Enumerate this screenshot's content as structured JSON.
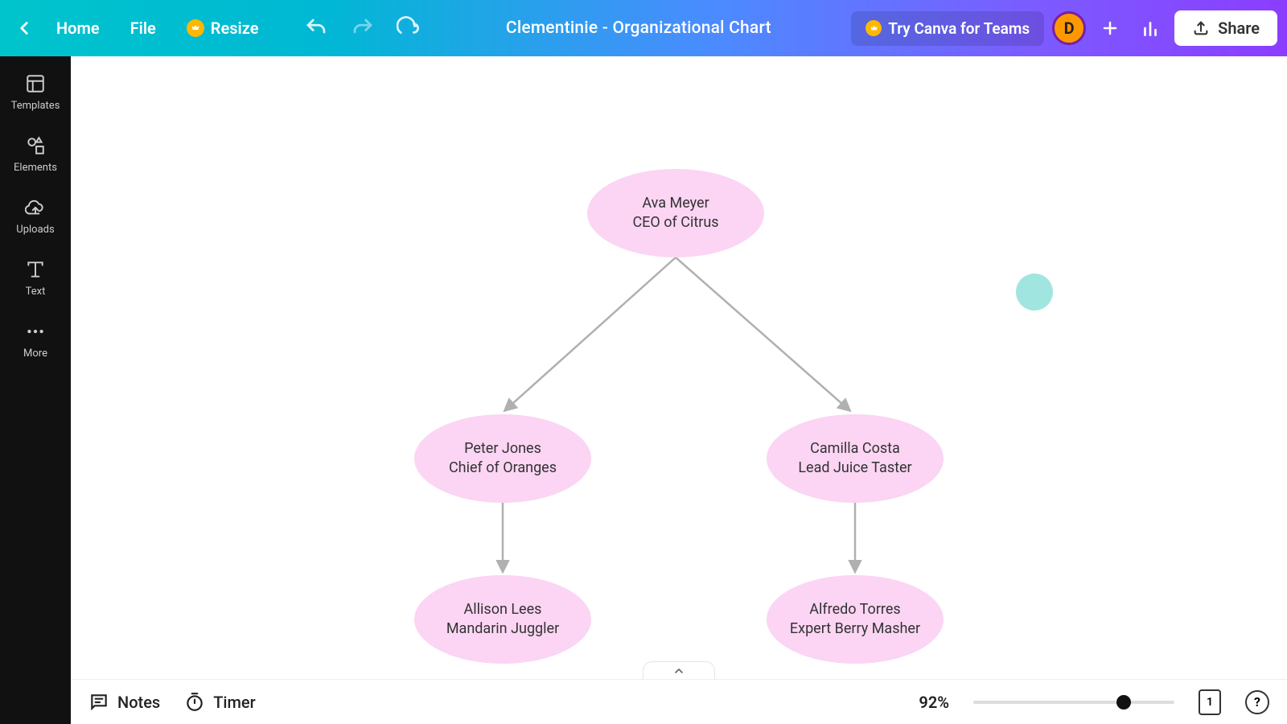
{
  "topbar": {
    "home": "Home",
    "file": "File",
    "resize": "Resize",
    "title": "Clementinie - Organizational Chart",
    "try_teams": "Try Canva for Teams",
    "avatar_letter": "D",
    "share": "Share"
  },
  "sidebar": {
    "templates": "Templates",
    "elements": "Elements",
    "uploads": "Uploads",
    "text": "Text",
    "more": "More"
  },
  "chart_data": {
    "type": "org-chart",
    "nodes": [
      {
        "id": "ceo",
        "name": "Ava Meyer",
        "title": "CEO of Citrus"
      },
      {
        "id": "peter",
        "name": "Peter Jones",
        "title": "Chief of Oranges"
      },
      {
        "id": "camilla",
        "name": "Camilla Costa",
        "title": "Lead Juice Taster"
      },
      {
        "id": "allison",
        "name": "Allison Lees",
        "title": "Mandarin Juggler"
      },
      {
        "id": "alfredo",
        "name": "Alfredo Torres",
        "title": "Expert Berry Masher"
      }
    ],
    "edges": [
      [
        "ceo",
        "peter"
      ],
      [
        "ceo",
        "camilla"
      ],
      [
        "peter",
        "allison"
      ],
      [
        "camilla",
        "alfredo"
      ]
    ]
  },
  "bottombar": {
    "notes": "Notes",
    "timer": "Timer",
    "zoom": "92%",
    "page": "1"
  }
}
